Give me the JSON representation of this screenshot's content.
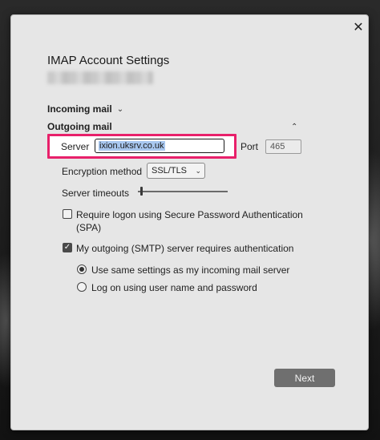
{
  "dialog": {
    "close_glyph": "✕",
    "title": "IMAP Account Settings"
  },
  "incoming": {
    "label": "Incoming mail",
    "chevron": "⌄"
  },
  "outgoing": {
    "label": "Outgoing mail",
    "chevron": "⌃",
    "server_label": "Server",
    "server_value": "ixion.uksrv.co.uk",
    "port_label": "Port",
    "port_value": "465",
    "encryption_label": "Encryption method",
    "encryption_value": "SSL/TLS",
    "encryption_caret": "⌄",
    "timeouts_label": "Server timeouts",
    "timeout_level": 0.03,
    "spa_label_line1": "Require logon using Secure Password Authentication",
    "spa_label_line2": "(SPA)",
    "spa_checked": false,
    "smtp_auth_label": "My outgoing (SMTP) server requires authentication",
    "smtp_auth_checked": true,
    "check_glyph": "✓",
    "auth_options": [
      {
        "label": "Use same settings as my incoming mail server",
        "selected": true
      },
      {
        "label": "Log on using user name and password",
        "selected": false
      }
    ]
  },
  "footer": {
    "next_label": "Next"
  },
  "colors": {
    "highlight": "#e8206a",
    "selection": "#a8c7ef",
    "button": "#6f6f6f"
  },
  "icons": [
    "close-icon",
    "chevron-down-icon",
    "chevron-up-icon",
    "checkmark-icon"
  ]
}
